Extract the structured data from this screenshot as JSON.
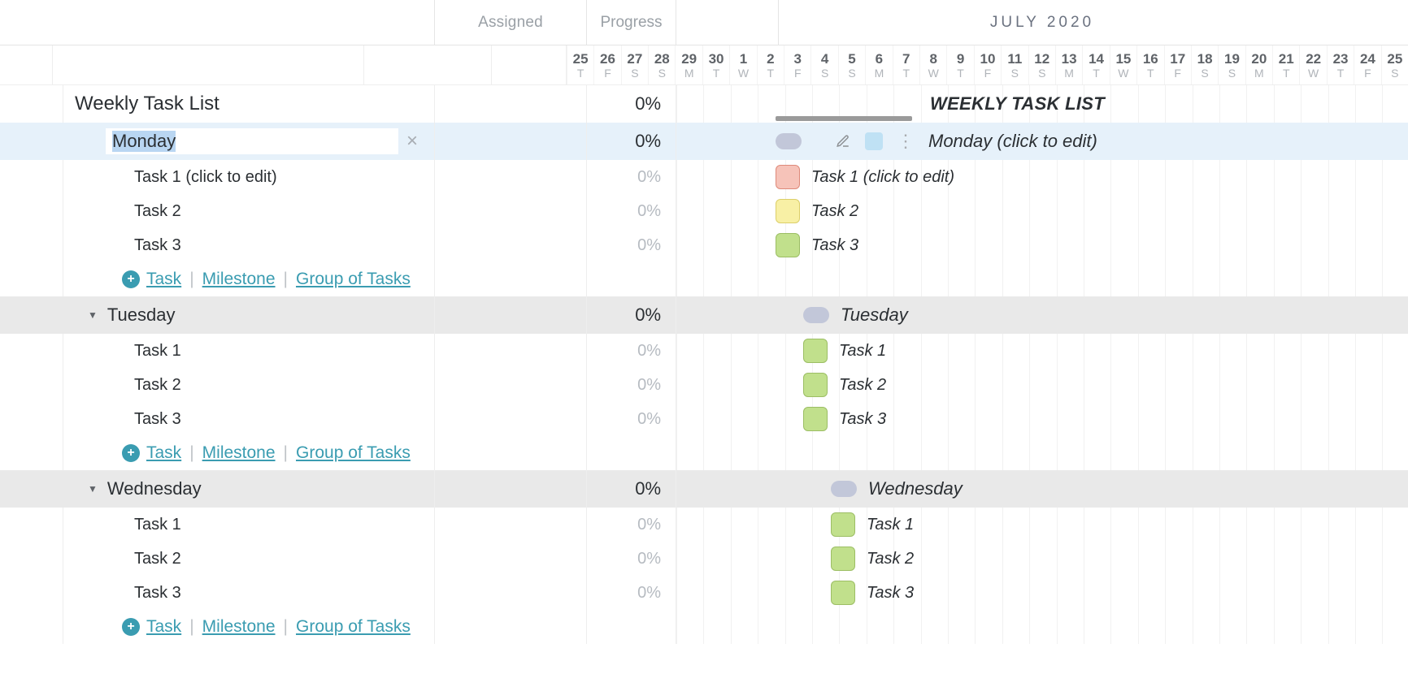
{
  "header": {
    "assigned_label": "Assigned",
    "progress_label": "Progress",
    "month_label": "JULY 2020"
  },
  "columns": {
    "dates": [
      {
        "d": "25",
        "w": "T"
      },
      {
        "d": "26",
        "w": "F"
      },
      {
        "d": "27",
        "w": "S"
      },
      {
        "d": "28",
        "w": "S"
      },
      {
        "d": "29",
        "w": "M"
      },
      {
        "d": "30",
        "w": "T"
      },
      {
        "d": "1",
        "w": "W"
      },
      {
        "d": "2",
        "w": "T"
      },
      {
        "d": "3",
        "w": "F"
      },
      {
        "d": "4",
        "w": "S"
      },
      {
        "d": "5",
        "w": "S"
      },
      {
        "d": "6",
        "w": "M"
      },
      {
        "d": "7",
        "w": "T"
      },
      {
        "d": "8",
        "w": "W"
      },
      {
        "d": "9",
        "w": "T"
      },
      {
        "d": "10",
        "w": "F"
      },
      {
        "d": "11",
        "w": "S"
      },
      {
        "d": "12",
        "w": "S"
      },
      {
        "d": "13",
        "w": "M"
      },
      {
        "d": "14",
        "w": "T"
      },
      {
        "d": "15",
        "w": "W"
      },
      {
        "d": "16",
        "w": "T"
      },
      {
        "d": "17",
        "w": "F"
      },
      {
        "d": "18",
        "w": "S"
      },
      {
        "d": "19",
        "w": "S"
      },
      {
        "d": "20",
        "w": "M"
      },
      {
        "d": "21",
        "w": "T"
      },
      {
        "d": "22",
        "w": "W"
      },
      {
        "d": "23",
        "w": "T"
      },
      {
        "d": "24",
        "w": "F"
      },
      {
        "d": "25",
        "w": "S"
      }
    ]
  },
  "project": {
    "title": "Weekly Task List",
    "progress": "0%",
    "gantt_label": "WEEKLY TASK LIST"
  },
  "groups": [
    {
      "name": "Monday",
      "progress": "0%",
      "editing": true,
      "gantt_label": "Monday (click to edit)",
      "tasks": [
        {
          "name": "Task 1 (click to edit)",
          "progress": "0%",
          "color": "red",
          "gantt_label": "Task 1 (click to edit)"
        },
        {
          "name": "Task 2",
          "progress": "0%",
          "color": "yellow",
          "gantt_label": "Task 2"
        },
        {
          "name": "Task 3",
          "progress": "0%",
          "color": "green",
          "gantt_label": "Task 3"
        }
      ]
    },
    {
      "name": "Tuesday",
      "progress": "0%",
      "gantt_label": "Tuesday",
      "tasks": [
        {
          "name": "Task 1",
          "progress": "0%",
          "color": "green",
          "gantt_label": "Task 1"
        },
        {
          "name": "Task 2",
          "progress": "0%",
          "color": "green",
          "gantt_label": "Task 2"
        },
        {
          "name": "Task 3",
          "progress": "0%",
          "color": "green",
          "gantt_label": "Task 3"
        }
      ]
    },
    {
      "name": "Wednesday",
      "progress": "0%",
      "gantt_label": "Wednesday",
      "tasks": [
        {
          "name": "Task 1",
          "progress": "0%",
          "color": "green",
          "gantt_label": "Task 1"
        },
        {
          "name": "Task 2",
          "progress": "0%",
          "color": "green",
          "gantt_label": "Task 2"
        },
        {
          "name": "Task 3",
          "progress": "0%",
          "color": "green",
          "gantt_label": "Task 3"
        }
      ]
    }
  ],
  "add_links": {
    "task": "Task",
    "milestone": "Milestone",
    "group": "Group of Tasks"
  }
}
